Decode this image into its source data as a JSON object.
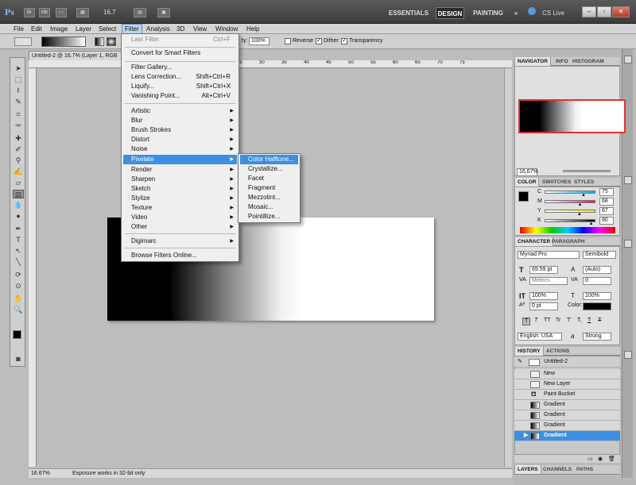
{
  "app": {
    "logo": "Ps",
    "zoom": "16.7",
    "workspaces": [
      "ESSENTIALS",
      "DESIGN",
      "PAINTING"
    ],
    "workspace_more": "»",
    "cs_live": "CS Live"
  },
  "menubar": [
    "File",
    "Edit",
    "Image",
    "Layer",
    "Select",
    "Filter",
    "Analysis",
    "3D",
    "View",
    "Window",
    "Help"
  ],
  "options": {
    "opacity_label": "ty:",
    "opacity_value": "100%",
    "reverse": "Reverse",
    "dither": "Dither",
    "transparency": "Transparency"
  },
  "document": {
    "tab_title": "Untitled-2 @ 16.7% (Layer 1, RGB",
    "zoom_status": "16.67%",
    "status_text": "Exposure works in 32-bit only"
  },
  "ruler_marks": [
    "25",
    "30",
    "35",
    "40",
    "45",
    "50",
    "55",
    "60",
    "65",
    "70",
    "75"
  ],
  "filter_menu": {
    "items": [
      {
        "label": "Last Filter",
        "shortcut": "Ctrl+F",
        "disabled": true
      },
      {
        "sep": true
      },
      {
        "label": "Convert for Smart Filters"
      },
      {
        "sep": true
      },
      {
        "label": "Filter Gallery..."
      },
      {
        "label": "Lens Correction...",
        "shortcut": "Shift+Ctrl+R"
      },
      {
        "label": "Liquify...",
        "shortcut": "Shift+Ctrl+X"
      },
      {
        "label": "Vanishing Point...",
        "shortcut": "Alt+Ctrl+V"
      },
      {
        "sep": true
      },
      {
        "label": "Artistic",
        "submenu": true
      },
      {
        "label": "Blur",
        "submenu": true
      },
      {
        "label": "Brush Strokes",
        "submenu": true
      },
      {
        "label": "Distort",
        "submenu": true
      },
      {
        "label": "Noise",
        "submenu": true
      },
      {
        "label": "Pixelate",
        "submenu": true,
        "highlighted": true
      },
      {
        "label": "Render",
        "submenu": true
      },
      {
        "label": "Sharpen",
        "submenu": true
      },
      {
        "label": "Sketch",
        "submenu": true
      },
      {
        "label": "Stylize",
        "submenu": true
      },
      {
        "label": "Texture",
        "submenu": true
      },
      {
        "label": "Video",
        "submenu": true
      },
      {
        "label": "Other",
        "submenu": true
      },
      {
        "sep": true
      },
      {
        "label": "Digimarc",
        "submenu": true
      },
      {
        "sep": true
      },
      {
        "label": "Browse Filters Online..."
      }
    ]
  },
  "pixelate_submenu": [
    "Color Halftone...",
    "Crystallize...",
    "Facet",
    "Fragment",
    "Mezzotint...",
    "Mosaic...",
    "Pointillize..."
  ],
  "panels": {
    "navigator": {
      "tabs": [
        "NAVIGATOR",
        "INFO",
        "HISTOGRAM"
      ],
      "zoom": "16.67%"
    },
    "color": {
      "tabs": [
        "COLOR",
        "SWATCHES",
        "STYLES"
      ],
      "channels": [
        {
          "name": "C",
          "value": "75",
          "level": 75
        },
        {
          "name": "M",
          "value": "68",
          "level": 68
        },
        {
          "name": "Y",
          "value": "67",
          "level": 67
        },
        {
          "name": "K",
          "value": "90",
          "level": 90
        }
      ]
    },
    "character": {
      "tabs": [
        "CHARACTER",
        "PARAGRAPH"
      ],
      "font_family": "Myriad Pro",
      "font_style": "Semibold",
      "size": "69.59 pt",
      "leading": "(Auto)",
      "kerning": "Metrics",
      "tracking": "0",
      "vscale": "100%",
      "hscale": "100%",
      "baseline": "0 pt",
      "color_label": "Color:",
      "language": "English: USA",
      "aa_label": "a",
      "antialias": "Strong",
      "text_styles": [
        "T",
        "T",
        "TT",
        "Tr",
        "T'",
        "T,",
        "T",
        "T"
      ]
    },
    "history": {
      "tabs": [
        "HISTORY",
        "ACTIONS"
      ],
      "snapshot": "Untitled-2",
      "steps": [
        "New",
        "New Layer",
        "Paint Bucket",
        "Gradient",
        "Gradient",
        "Gradient",
        "Gradient"
      ]
    },
    "bottom_tabs": [
      "LAYERS",
      "CHANNELS",
      "PATHS"
    ]
  },
  "colors": {
    "highlight": "#3d8fe0",
    "foreground": "#000000",
    "background": "#ffffff"
  }
}
